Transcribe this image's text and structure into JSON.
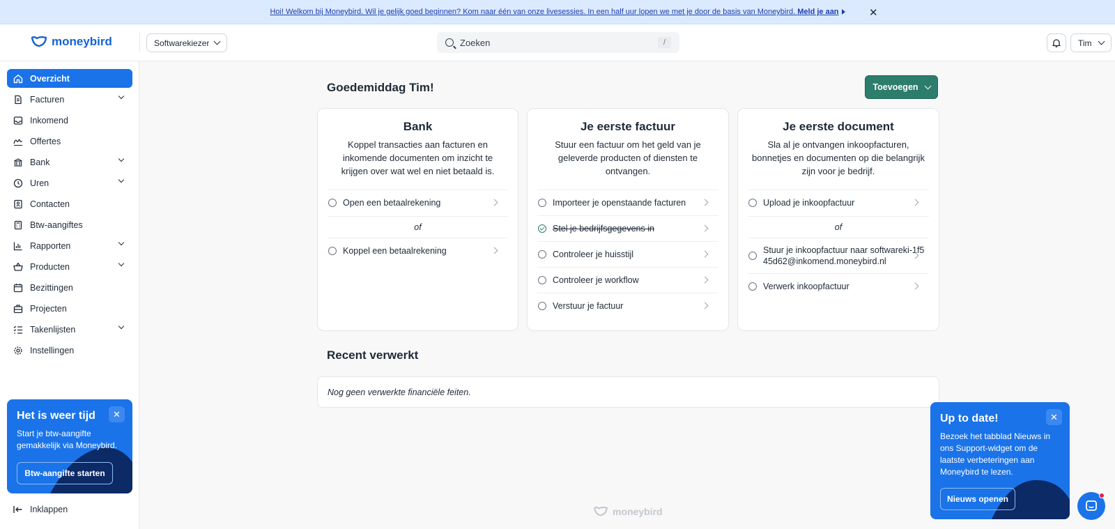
{
  "banner": {
    "text": "Hoi! Welkom bij Moneybird. Wil je gelijk goed beginnen? Kom naar één van onze livesessies. In een half uur lopen we met je door de basis van Moneybird.",
    "cta": "Meld je aan"
  },
  "topbar": {
    "logo": "moneybird",
    "company": "Softwarekiezer",
    "search_placeholder": "Zoeken",
    "search_shortcut": "/",
    "user": "Tim"
  },
  "sidebar": {
    "items": [
      {
        "label": "Overzicht"
      },
      {
        "label": "Facturen"
      },
      {
        "label": "Inkomend"
      },
      {
        "label": "Offertes"
      },
      {
        "label": "Bank"
      },
      {
        "label": "Uren"
      },
      {
        "label": "Contacten"
      },
      {
        "label": "Btw-aangiftes"
      },
      {
        "label": "Rapporten"
      },
      {
        "label": "Producten"
      },
      {
        "label": "Bezittingen"
      },
      {
        "label": "Projecten"
      },
      {
        "label": "Takenlijsten"
      },
      {
        "label": "Instellingen"
      }
    ],
    "promo": {
      "title": "Het is weer tijd",
      "text": "Start je btw-aangifte gemakkelijk via Moneybird.",
      "button": "Btw-aangifte starten"
    },
    "collapse": "Inklappen"
  },
  "main": {
    "greeting": "Goedemiddag Tim!",
    "add_button": "Toevoegen",
    "cards": [
      {
        "title": "Bank",
        "desc": "Koppel transacties aan facturen en inkomende documenten om inzicht te krijgen over wat wel en niet betaald is.",
        "tasks": [
          "Open een betaalrekening",
          "Koppel een betaalrekening"
        ],
        "or": "of"
      },
      {
        "title": "Je eerste factuur",
        "desc": "Stuur een factuur om het geld van je geleverde producten of diensten te ontvangen.",
        "tasks": [
          "Importeer je openstaande facturen",
          "Stel je bedrijfsgegevens in",
          "Controleer je huisstijl",
          "Controleer je workflow",
          "Verstuur je factuur"
        ]
      },
      {
        "title": "Je eerste document",
        "desc": "Sla al je ontvangen inkoopfacturen, bonnetjes en documenten op die belangrijk zijn voor je bedrijf.",
        "tasks": [
          "Upload je inkoopfactuur",
          "Stuur je inkoopfactuur naar softwareki-1f545d62@inkomend.moneybird.nl",
          "Verwerk inkoopfactuur"
        ],
        "or": "of"
      }
    ],
    "recent_title": "Recent verwerkt",
    "recent_empty": "Nog geen verwerkte financiële feiten.",
    "footer_logo": "moneybird"
  },
  "news": {
    "title": "Up to date!",
    "text": "Bezoek het tabblad Nieuws in ons Support-widget om de laatste verbeteringen aan Moneybird te lezen.",
    "button": "Nieuws openen"
  },
  "colors": {
    "brand_blue": "#1a73e8",
    "accent_green": "#2d7d6d"
  }
}
